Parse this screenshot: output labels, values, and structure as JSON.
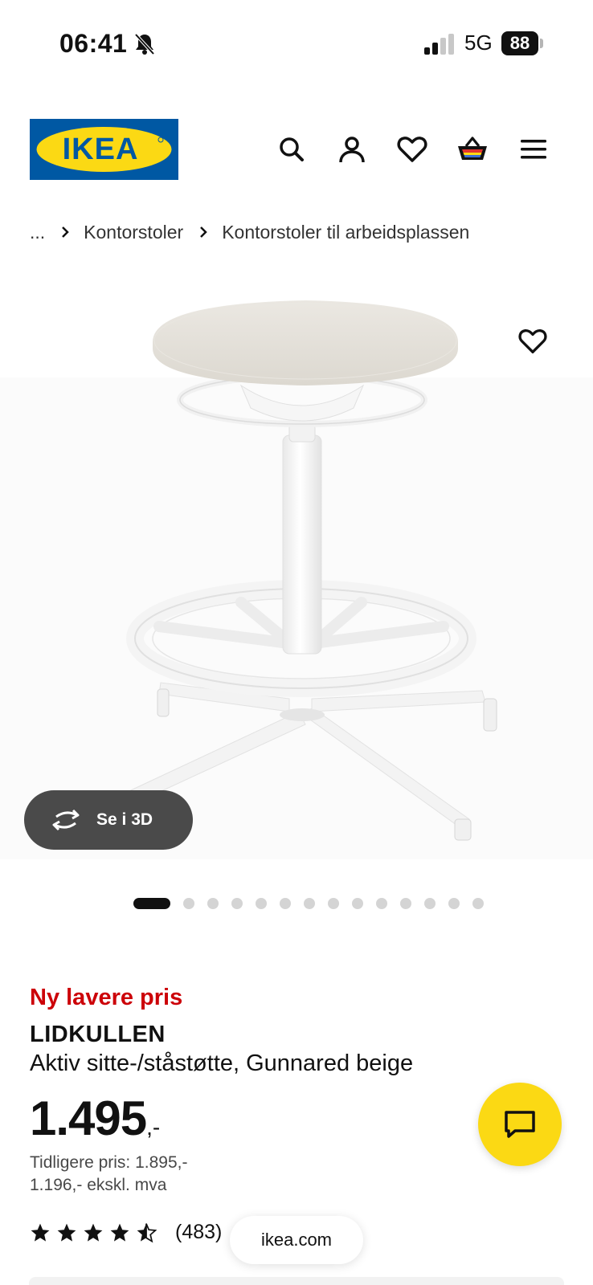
{
  "status_bar": {
    "time": "06:41",
    "network": "5G",
    "battery": "88"
  },
  "header": {
    "logo_text": "IKEA",
    "icons": [
      "search-icon",
      "account-icon",
      "favourites-heart-icon",
      "shopping-basket-icon",
      "menu-icon"
    ]
  },
  "breadcrumb": {
    "items": [
      "...",
      "Kontorstoler",
      "Kontorstoler til arbeidsplassen"
    ]
  },
  "gallery": {
    "view_3d_label": "Se i 3D",
    "dot_count": 14,
    "active_index": 0
  },
  "product": {
    "price_tag": "Ny lavere pris",
    "name": "LIDKULLEN",
    "description": "Aktiv sitte-/ståstøtte, Gunnared beige",
    "price_main": "1.495",
    "price_suffix": ",-",
    "previous_price": "Tidligere pris: 1.895,-",
    "ex_vat_price": "1.196,- ekskl. mva",
    "rating": 4.5,
    "review_count": "(483)"
  },
  "browser": {
    "url": "ikea.com"
  },
  "colors": {
    "ikea_blue": "#0058a3",
    "ikea_yellow": "#fbd914",
    "price_red": "#cc0008"
  }
}
